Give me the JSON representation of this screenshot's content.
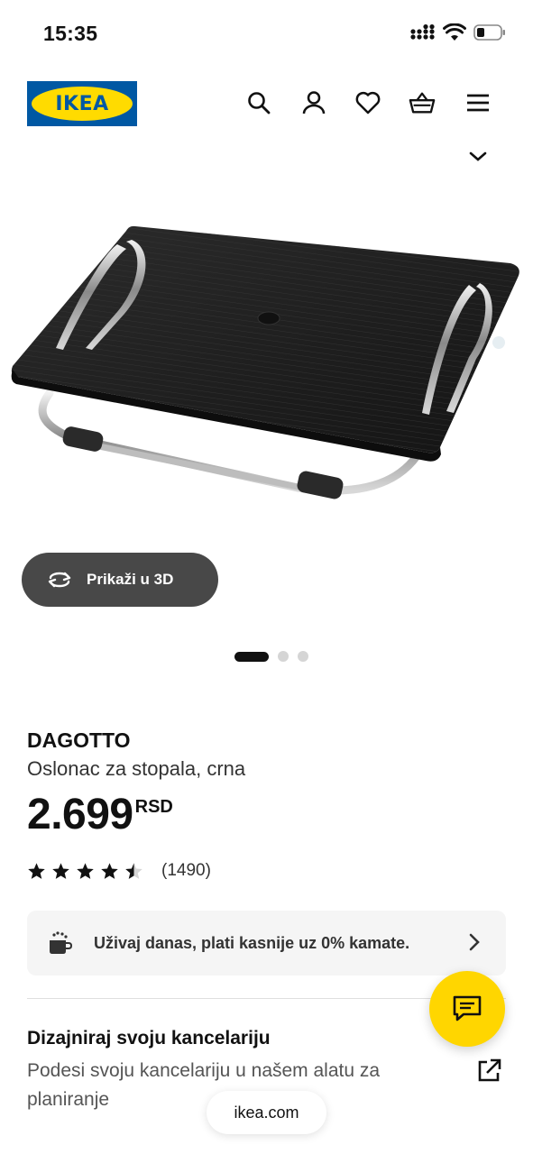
{
  "status_bar": {
    "time": "15:35"
  },
  "header": {
    "logo_text": "IKEA",
    "icons": [
      "search-icon",
      "account-icon",
      "heart-icon",
      "cart-icon",
      "menu-icon"
    ]
  },
  "gallery": {
    "view_3d_label": "Prikaži u 3D",
    "image_count": 3,
    "active_index": 0
  },
  "product": {
    "name": "DAGOTTO",
    "description": "Oslonac za stopala, crna",
    "price": "2.699",
    "currency": "RSD",
    "rating": 4.5,
    "review_count": "(1490)"
  },
  "promo": {
    "text": "Uživaj danas, plati kasnije uz 0% kamate."
  },
  "planner": {
    "title": "Dizajniraj svoju kancelariju",
    "description": "Podesi svoju kancelariju u našem alatu za planiranje"
  },
  "browser": {
    "url": "ikea.com"
  },
  "colors": {
    "ikea_blue": "#0058a3",
    "ikea_yellow": "#ffdb00",
    "chat_yellow": "#ffd600",
    "button_dark": "#484848"
  }
}
